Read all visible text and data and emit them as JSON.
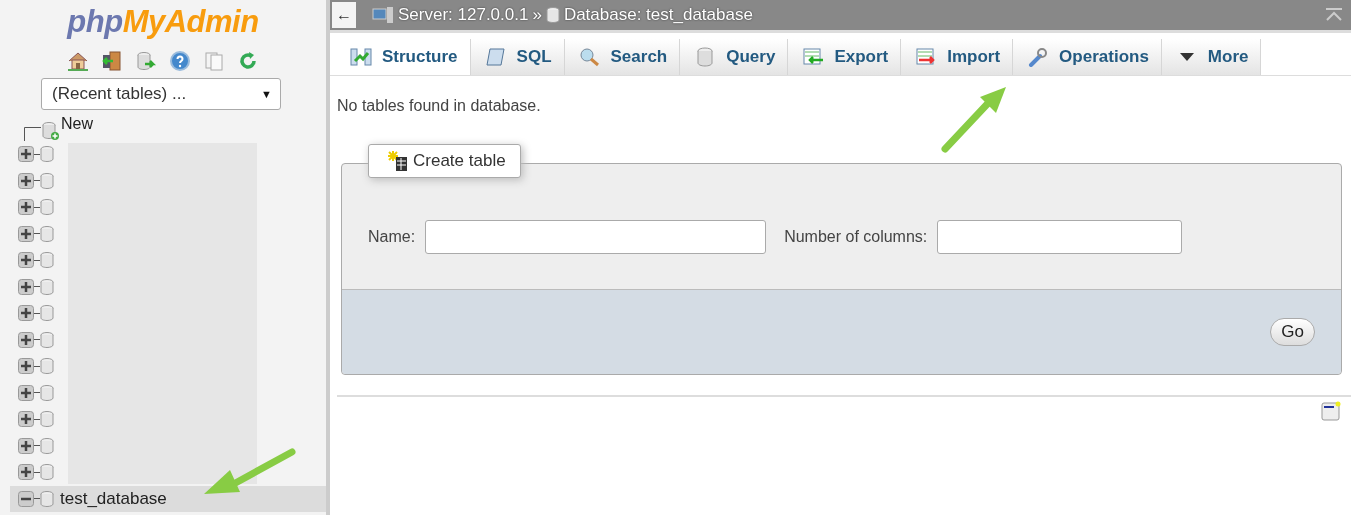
{
  "sidebar": {
    "logo": {
      "part1": "php",
      "part2": "MyAdmin"
    },
    "recent_tables": {
      "value": "(Recent tables) ...",
      "caret": "▼"
    },
    "new_item": {
      "label": "New"
    },
    "tree": [
      {
        "expanded": false,
        "selected": false
      },
      {
        "expanded": false,
        "selected": false
      },
      {
        "expanded": false,
        "selected": false
      },
      {
        "expanded": false,
        "selected": false
      },
      {
        "expanded": false,
        "selected": false
      },
      {
        "expanded": false,
        "selected": false
      },
      {
        "expanded": false,
        "selected": false
      },
      {
        "expanded": false,
        "selected": false
      },
      {
        "expanded": false,
        "selected": false
      },
      {
        "expanded": false,
        "selected": false
      },
      {
        "expanded": false,
        "selected": false
      },
      {
        "expanded": false,
        "selected": false
      },
      {
        "expanded": false,
        "selected": false
      },
      {
        "name": "test_database",
        "expanded": true,
        "selected": true
      }
    ]
  },
  "breadcrumb": {
    "back": "←",
    "server": "Server: 127.0.0.1",
    "separator": "»",
    "database": "Database: test_database"
  },
  "tabs": [
    {
      "label": "Structure",
      "selected": true
    },
    {
      "label": "SQL",
      "selected": false
    },
    {
      "label": "Search",
      "selected": false
    },
    {
      "label": "Query",
      "selected": false
    },
    {
      "label": "Export",
      "selected": false
    },
    {
      "label": "Import",
      "selected": false
    },
    {
      "label": "Operations",
      "selected": false
    },
    {
      "label": "More",
      "selected": false
    }
  ],
  "message": "No tables found in database.",
  "create_table": {
    "legend": "Create table",
    "name_label": "Name:",
    "columns_label": "Number of columns:",
    "go": "Go"
  }
}
